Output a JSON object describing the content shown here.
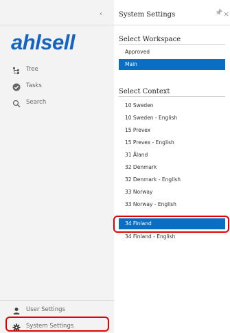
{
  "sidebar": {
    "logo": "ahlsell",
    "collapse_glyph": "‹",
    "items": [
      {
        "label": "Tree",
        "icon": "tree-icon"
      },
      {
        "label": "Tasks",
        "icon": "tasks-check-icon"
      },
      {
        "label": "Search",
        "icon": "search-icon"
      }
    ],
    "footer": [
      {
        "label": "User Settings",
        "icon": "user-icon"
      },
      {
        "label": "System Settings",
        "icon": "gear-icon"
      }
    ]
  },
  "panel": {
    "title": "System Settings",
    "pin_glyph": "📌",
    "close_glyph": "×",
    "workspace": {
      "heading": "Select Workspace",
      "items": [
        "Approved",
        "Main"
      ],
      "selected": "Main"
    },
    "context": {
      "heading": "Select Context",
      "items": [
        "10 Sweden",
        "10 Sweden - English",
        "15 Prevex",
        "15 Prevex - English",
        "31 Åland",
        "32 Denmark",
        "32 Denmark - English",
        "33 Norway",
        "33 Norway - English",
        "34 Finland",
        "34 Finland - English"
      ],
      "selected": "34 Finland"
    }
  },
  "colors": {
    "brand": "#1565c0",
    "selection": "#0a6fc2",
    "highlight": "#e00000"
  }
}
